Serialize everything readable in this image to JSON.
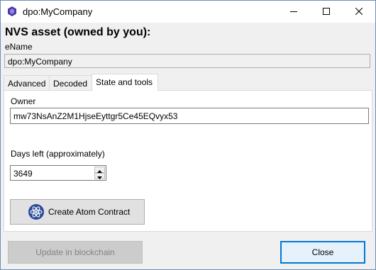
{
  "window": {
    "title": "dpo:MyCompany",
    "icons": {
      "app": "app-logo-icon",
      "minimize": "minimize-icon",
      "maximize": "maximize-icon",
      "close": "close-icon"
    }
  },
  "heading": "NVS asset (owned by you):",
  "ename": {
    "label": "eName",
    "value": "dpo:MyCompany"
  },
  "tabs": [
    {
      "label": "Advanced",
      "active": false
    },
    {
      "label": "Decoded",
      "active": false
    },
    {
      "label": "State and tools",
      "active": true
    }
  ],
  "state_tab": {
    "owner_label": "Owner",
    "owner_value": "mw73NsAnZ2M1HjseEyttgr5Ce45EQvyx53",
    "days_label": "Days left (approximately)",
    "days_value": "3649",
    "atom_button_label": "Create Atom Contract",
    "atom_icon": "atom-icon"
  },
  "footer": {
    "update_label": "Update in blockchain",
    "close_label": "Close"
  },
  "colors": {
    "accent": "#0078d7",
    "window_border": "#6a8fb8",
    "dialog_bg": "#f0f0f0"
  }
}
